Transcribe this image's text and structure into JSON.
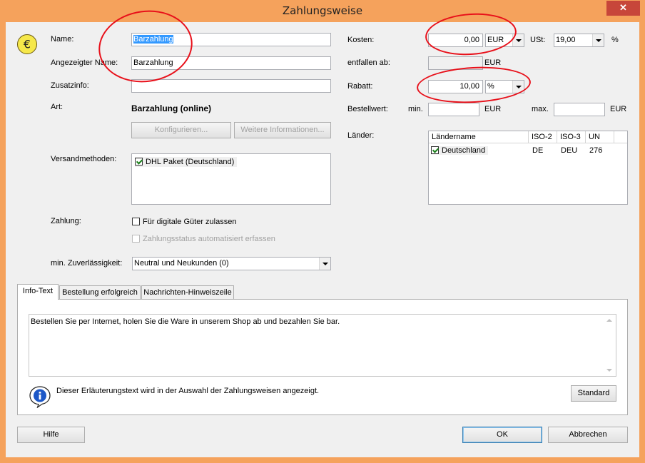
{
  "window": {
    "title": "Zahlungsweise",
    "close_glyph": "✕"
  },
  "form": {
    "name_label": "Name:",
    "name_value": "Barzahlung",
    "display_name_label": "Angezeigter Name:",
    "display_name_value": "Barzahlung",
    "extra_info_label": "Zusatzinfo:",
    "extra_info_value": "",
    "type_label": "Art:",
    "type_value": "Barzahlung (online)",
    "configure_button": "Konfigurieren...",
    "more_info_button": "Weitere Informationen...",
    "shipping_label": "Versandmethoden:",
    "shipping_methods": [
      {
        "label": "DHL Paket (Deutschland)",
        "checked": true
      }
    ],
    "payment_label": "Zahlung:",
    "digital_goods_label": "Für digitale Güter zulassen",
    "auto_status_label": "Zahlungsstatus automatisiert erfassen",
    "reliability_label": "min. Zuverlässigkeit:",
    "reliability_value": "Neutral und Neukunden (0)"
  },
  "costs": {
    "costs_label": "Kosten:",
    "costs_value": "0,00",
    "currency_value": "EUR",
    "vat_label": "USt:",
    "vat_value": "19,00",
    "percent_sign": "%",
    "dropped_from_label": "entfallen ab:",
    "dropped_from_value": "",
    "dropped_from_unit": "EUR",
    "discount_label": "Rabatt:",
    "discount_value": "10,00",
    "discount_unit": "%",
    "order_value_label": "Bestellwert:",
    "min_label": "min.",
    "min_value": "",
    "min_unit": "EUR",
    "max_label": "max.",
    "max_value": "",
    "max_unit": "EUR"
  },
  "countries": {
    "label": "Länder:",
    "columns": [
      "Ländername",
      "ISO-2",
      "ISO-3",
      "UN"
    ],
    "rows": [
      {
        "name": "Deutschland",
        "iso2": "DE",
        "iso3": "DEU",
        "un": "276",
        "checked": true
      }
    ]
  },
  "tabs": [
    {
      "label": "Info-Text",
      "active": true
    },
    {
      "label": "Bestellung erfolgreich",
      "active": false
    },
    {
      "label": "Nachrichten-Hinweiszeile",
      "active": false
    }
  ],
  "info": {
    "text": "Bestellen Sie per Internet, holen Sie die Ware in unserem Shop ab und bezahlen Sie bar.",
    "hint": "Dieser Erläuterungstext wird in der Auswahl der Zahlungsweisen angezeigt.",
    "standard_button": "Standard"
  },
  "footer": {
    "help_button": "Hilfe",
    "ok_button": "OK",
    "cancel_button": "Abbrechen"
  },
  "icons": {
    "currency": "euro-coin-icon",
    "info": "info-icon"
  },
  "colors": {
    "titlebar": "#f5a25c",
    "close": "#c7463a",
    "annotation": "#e8101a",
    "selection": "#3399ff"
  }
}
